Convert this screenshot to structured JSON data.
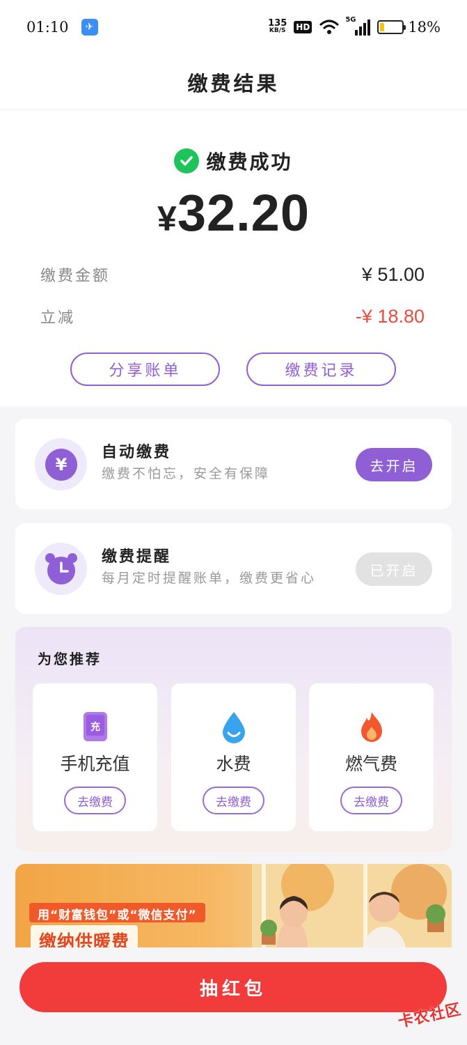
{
  "status_bar": {
    "time": "01:10",
    "net_speed_value": "135",
    "net_speed_unit": "KB/S",
    "hd": "HD",
    "network": "5G",
    "battery_percent": "18%",
    "battery_level": 0.18
  },
  "header": {
    "title": "缴费结果"
  },
  "result": {
    "status": "缴费成功",
    "currency": "¥",
    "amount": "32.20",
    "details": [
      {
        "label": "缴费金额",
        "value": "¥ 51.00"
      },
      {
        "label": "立减",
        "value": "-¥ 18.80"
      }
    ],
    "share_button": "分享账单",
    "record_button": "缴费记录"
  },
  "auto_pay": {
    "title": "自动缴费",
    "subtitle": "缴费不怕忘，安全有保障",
    "button": "去开启"
  },
  "reminder": {
    "title": "缴费提醒",
    "subtitle": "每月定时提醒账单，缴费更省心",
    "button": "已开启"
  },
  "recommend": {
    "title": "为您推荐",
    "items": [
      {
        "name": "手机充值",
        "button": "去缴费",
        "icon": "phone-recharge-icon"
      },
      {
        "name": "水费",
        "button": "去缴费",
        "icon": "water-drop-icon"
      },
      {
        "name": "燃气费",
        "button": "去缴费",
        "icon": "flame-icon"
      }
    ]
  },
  "banner": {
    "tag": "用“财富钱包”或“微信支付”",
    "headline": "缴纳供暖费"
  },
  "bottom": {
    "lottery_button": "抽红包"
  },
  "watermark": "卡农社区",
  "colors": {
    "accent": "#8f5fd6",
    "success": "#1ec35a",
    "discount": "#f04a3c",
    "cta": "#f23b3b"
  }
}
